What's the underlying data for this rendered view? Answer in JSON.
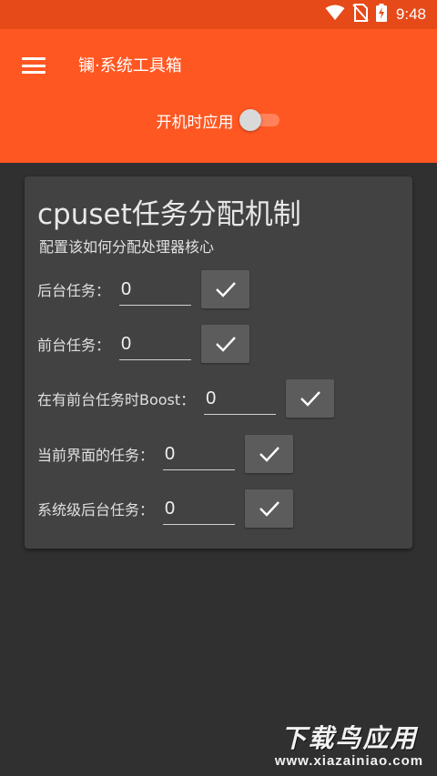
{
  "status_bar": {
    "time": "9:48",
    "icons": [
      "wifi-icon",
      "no-sim-icon",
      "battery-charging-icon"
    ]
  },
  "app_bar": {
    "menu_icon": "hamburger-menu-icon",
    "title": "镧·系统工具箱",
    "boot_label": "开机时应用",
    "boot_enabled": false
  },
  "card": {
    "title": "cpuset任务分配机制",
    "subtitle": "配置该如何分配处理器核心",
    "rows": [
      {
        "label": "后台任务：",
        "value": "0",
        "action_icon": "check-icon"
      },
      {
        "label": "前台任务：",
        "value": "0",
        "action_icon": "check-icon"
      },
      {
        "label": "在有前台任务时Boost：",
        "value": "0",
        "action_icon": "check-icon"
      },
      {
        "label": "当前界面的任务：",
        "value": "0",
        "action_icon": "check-icon"
      },
      {
        "label": "系统级后台任务：",
        "value": "0",
        "action_icon": "check-icon"
      }
    ]
  },
  "watermark": {
    "title": "下载鸟应用",
    "url": "www.xiazainiao.com"
  },
  "colors": {
    "status_bar": "#e64a19",
    "app_bar": "#ff5722",
    "background": "#303030",
    "card": "#424242",
    "button": "#5c5c5c"
  }
}
